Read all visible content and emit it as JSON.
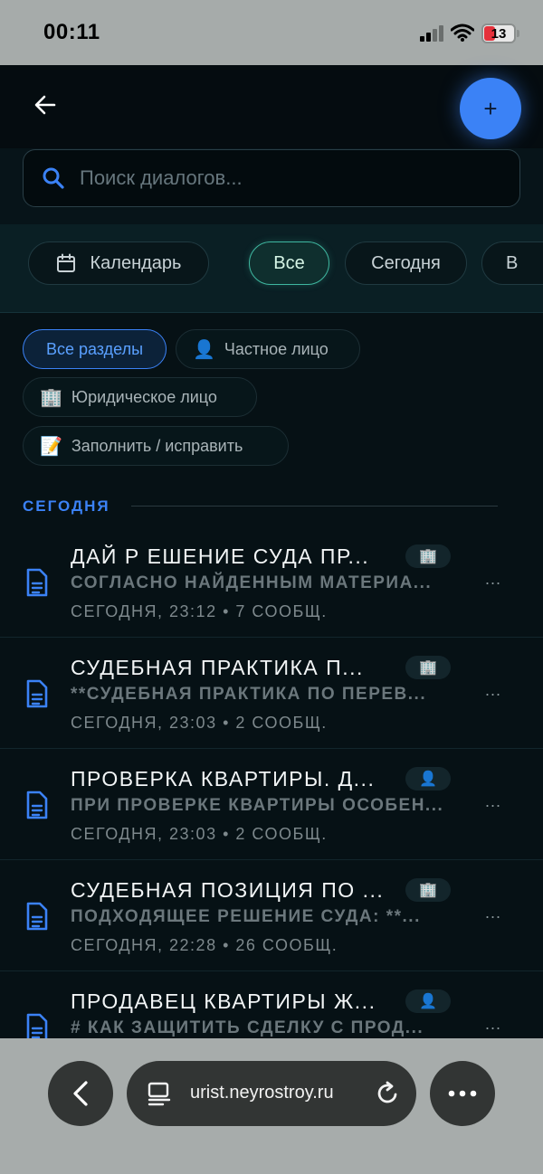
{
  "status_bar": {
    "time": "00:11",
    "battery": "13"
  },
  "header": {
    "back_label": "←",
    "add_label": "+"
  },
  "search": {
    "placeholder": "Поиск диалогов..."
  },
  "date_filters": [
    {
      "label": "Календарь",
      "icon": "calendar-icon"
    },
    {
      "label": "Все",
      "active": true
    },
    {
      "label": "Сегодня"
    },
    {
      "label": "В"
    }
  ],
  "categories": [
    {
      "label": "Все разделы",
      "active": true
    },
    {
      "label": "Частное лицо",
      "icon": "👤"
    },
    {
      "label": "Юридическое лицо",
      "icon": "🏢"
    },
    {
      "label": "Заполнить / исправить",
      "icon": "📝"
    }
  ],
  "section": {
    "title": "СЕГОДНЯ"
  },
  "dialogs": [
    {
      "title": "ДАЙ Р ЕШЕНИЕ СУДА ПР...",
      "preview": "СОГЛАСНО НАЙДЕННЫМ МАТЕРИА...",
      "meta": "СЕГОДНЯ, 23:12 • 7 СООБЩ.",
      "badge": "🏢",
      "more": "..."
    },
    {
      "title": "СУДЕБНАЯ ПРАКТИКА П...",
      "preview": "**СУДЕБНАЯ ПРАКТИКА ПО ПЕРЕВ...",
      "meta": "СЕГОДНЯ, 23:03 • 2 СООБЩ.",
      "badge": "🏢",
      "more": "..."
    },
    {
      "title": "ПРОВЕРКА КВАРТИРЫ. Д...",
      "preview": "ПРИ ПРОВЕРКЕ КВАРТИРЫ ОСОБЕН...",
      "meta": "СЕГОДНЯ, 23:03 • 2 СООБЩ.",
      "badge": "👤",
      "more": "..."
    },
    {
      "title": "СУДЕБНАЯ ПОЗИЦИЯ ПО ...",
      "preview": "ПОДХОДЯЩЕЕ РЕШЕНИЕ СУДА: **...",
      "meta": "СЕГОДНЯ, 22:28 • 26 СООБЩ.",
      "badge": "🏢",
      "more": "..."
    },
    {
      "title": "ПРОДАВЕЦ КВАРТИРЫ Ж...",
      "preview": "# КАК ЗАЩИТИТЬ СДЕЛКУ С ПРОД...",
      "meta": "",
      "badge": "👤",
      "more": "..."
    }
  ],
  "browser": {
    "url": "urist.neyrostroy.ru"
  },
  "colors": {
    "accent": "#3b82f6",
    "active_chip": "#3fb7a0",
    "background": "#061115"
  }
}
